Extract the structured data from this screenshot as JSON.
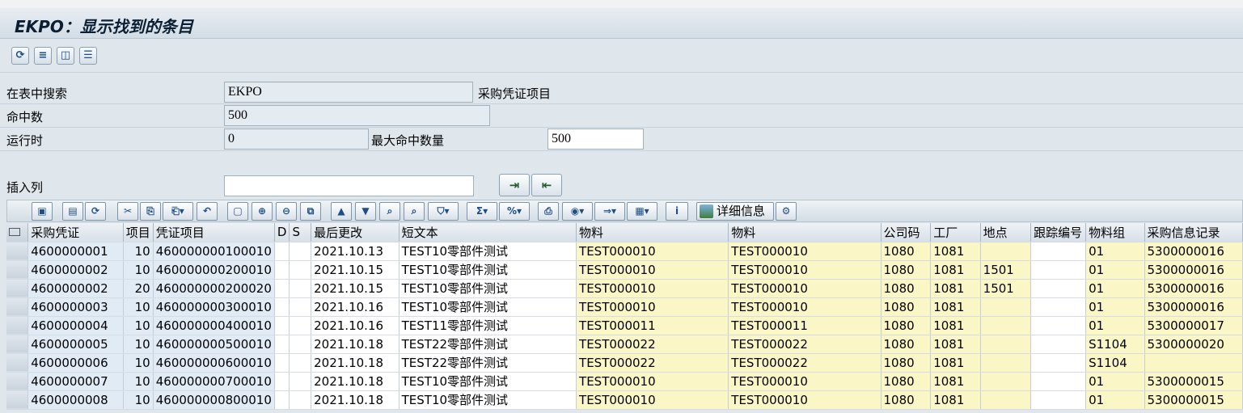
{
  "title": "EKPO：显示找到的条目",
  "app_toolbar": {
    "icons": [
      "refresh-icon",
      "layout-icon",
      "selection-icon",
      "list-icon"
    ]
  },
  "fields": {
    "search_table_label": "在表中搜索",
    "search_table_value": "EKPO",
    "search_table_desc": "采购凭证项目",
    "hits_label": "命中数",
    "hits_value": "500",
    "runtime_label": "运行时",
    "runtime_value": "0",
    "max_hits_label": "最大命中数量",
    "max_hits_value": "500",
    "insert_col_label": "插入列",
    "insert_col_value": ""
  },
  "grid_toolbar": {
    "details_label": "详细信息"
  },
  "table": {
    "columns": [
      "采购凭证",
      "项目",
      "凭证项目",
      "D",
      "S",
      "最后更改",
      "短文本",
      "物料",
      "物料",
      "公司码",
      "工厂",
      "地点",
      "跟踪编号",
      "物料组",
      "采购信息记录"
    ],
    "rows": [
      [
        "4600000001",
        "10",
        "460000000100010",
        "",
        "",
        "2021.10.13",
        "TEST10零部件测试",
        "TEST000010",
        "TEST000010",
        "1080",
        "1081",
        "",
        "",
        "01",
        "5300000016"
      ],
      [
        "4600000002",
        "10",
        "460000000200010",
        "",
        "",
        "2021.10.15",
        "TEST10零部件测试",
        "TEST000010",
        "TEST000010",
        "1080",
        "1081",
        "1501",
        "",
        "01",
        "5300000016"
      ],
      [
        "4600000002",
        "20",
        "460000000200020",
        "",
        "",
        "2021.10.15",
        "TEST10零部件测试",
        "TEST000010",
        "TEST000010",
        "1080",
        "1081",
        "1501",
        "",
        "01",
        "5300000016"
      ],
      [
        "4600000003",
        "10",
        "460000000300010",
        "",
        "",
        "2021.10.16",
        "TEST10零部件测试",
        "TEST000010",
        "TEST000010",
        "1080",
        "1081",
        "",
        "",
        "01",
        "5300000016"
      ],
      [
        "4600000004",
        "10",
        "460000000400010",
        "",
        "",
        "2021.10.16",
        "TEST11零部件测试",
        "TEST000011",
        "TEST000011",
        "1080",
        "1081",
        "",
        "",
        "01",
        "5300000017"
      ],
      [
        "4600000005",
        "10",
        "460000000500010",
        "",
        "",
        "2021.10.18",
        "TEST22零部件测试",
        "TEST000022",
        "TEST000022",
        "1080",
        "1081",
        "",
        "",
        "S1104",
        "5300000020"
      ],
      [
        "4600000006",
        "10",
        "460000000600010",
        "",
        "",
        "2021.10.18",
        "TEST22零部件测试",
        "TEST000022",
        "TEST000022",
        "1080",
        "1081",
        "",
        "",
        "S1104",
        ""
      ],
      [
        "4600000007",
        "10",
        "460000000700010",
        "",
        "",
        "2021.10.18",
        "TEST10零部件测试",
        "TEST000010",
        "TEST000010",
        "1080",
        "1081",
        "",
        "",
        "01",
        "5300000015"
      ],
      [
        "4600000008",
        "10",
        "460000000800010",
        "",
        "",
        "2021.10.18",
        "TEST10零部件测试",
        "TEST000010",
        "TEST000010",
        "1080",
        "1081",
        "",
        "",
        "01",
        "5300000015"
      ]
    ]
  }
}
